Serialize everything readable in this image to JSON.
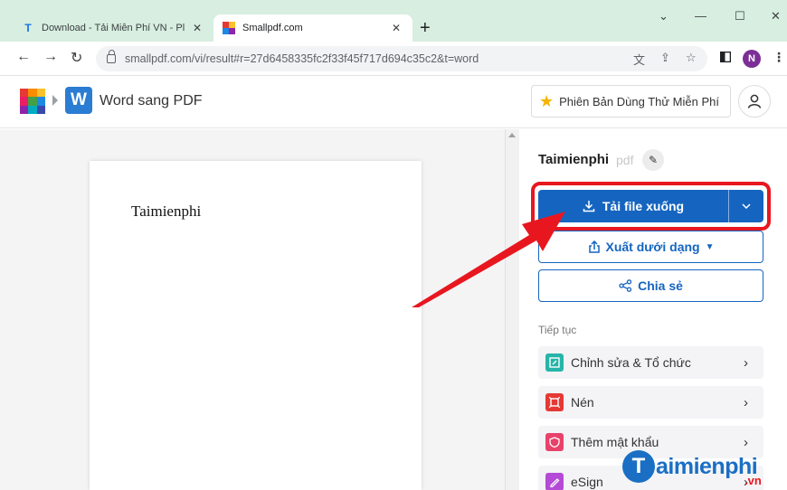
{
  "browser": {
    "tabs": [
      {
        "title": "Download - Tải Miễn Phí VN - Pl",
        "favicon": "T",
        "close": "✕"
      },
      {
        "title": "Smallpdf.com",
        "close": "✕"
      }
    ],
    "new_tab": "+",
    "window_controls": {
      "minimize": "—",
      "maximize": "☐",
      "close": "✕",
      "tab_search": "⌄"
    },
    "url": "smallpdf.com/vi/result#r=27d6458335fc2f33f45f717d694c35c2&t=word",
    "profile_initial": "N"
  },
  "app": {
    "word_badge": "W",
    "title": "Word sang PDF",
    "trial_label": "Phiên Bản Dùng Thử Miễn Phí"
  },
  "document": {
    "text": "Taimienphi"
  },
  "panel": {
    "file_name": "Taimienphi",
    "file_ext": "pdf",
    "download_label": "Tải file xuống",
    "export_label": "Xuất dưới dạng",
    "share_label": "Chia sẻ",
    "continue_label": "Tiếp tục",
    "tools": [
      {
        "label": "Chỉnh sửa & Tổ chức",
        "color": "#26b5a8"
      },
      {
        "label": "Nén",
        "color": "#e53935"
      },
      {
        "label": "Thêm mật khẩu",
        "color": "#e8416a"
      },
      {
        "label": "eSign",
        "color": "#b44ad6"
      }
    ]
  },
  "watermark": {
    "letter": "T",
    "text": "aimienphi",
    "suffix": ".vn"
  },
  "colors": {
    "primary": "#1565c0",
    "highlight_red": "#e8171f",
    "tab_strip": "#d7eee0"
  }
}
